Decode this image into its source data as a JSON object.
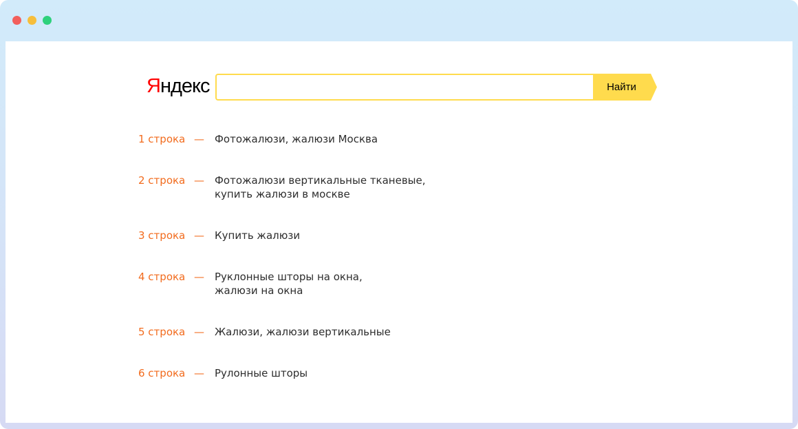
{
  "window": {
    "controls": [
      "close",
      "minimize",
      "maximize"
    ],
    "control_colors": [
      "#f25f5c",
      "#f6be3b",
      "#2ed17c"
    ]
  },
  "logo": {
    "first_letter": "Я",
    "rest": "ндекс",
    "first_letter_color": "#ff0000"
  },
  "search": {
    "value": "",
    "placeholder": "",
    "button_label": "Найти",
    "accent_color": "#ffdb4d"
  },
  "accent_color": "#f26b1d",
  "rows": [
    {
      "label": "1 строка",
      "dash": "—",
      "text": "Фотожалюзи, жалюзи Москва"
    },
    {
      "label": "2 строка",
      "dash": "—",
      "text": "Фотожалюзи вертикальные тканевые,\nкупить жалюзи в москве"
    },
    {
      "label": "3 строка",
      "dash": "—",
      "text": "Купить жалюзи"
    },
    {
      "label": "4 строка",
      "dash": "—",
      "text": "Руклонные шторы на окна,\nжалюзи на окна"
    },
    {
      "label": "5 строка",
      "dash": "—",
      "text": "Жалюзи, жалюзи вертикальные"
    },
    {
      "label": "6 строка",
      "dash": "—",
      "text": "Рулонные шторы"
    }
  ]
}
